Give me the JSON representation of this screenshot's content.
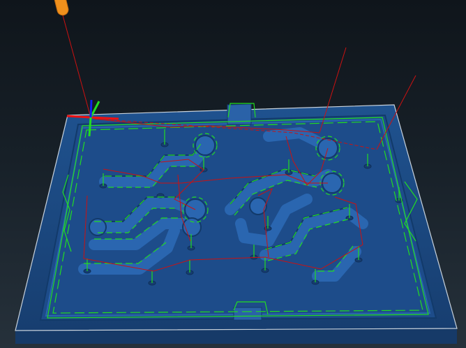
{
  "viewport": {
    "background_top": "#0f151b",
    "background_bottom": "#26313b"
  },
  "part": {
    "body_color": "#1f4f8f",
    "top_color": "#2760a8",
    "pocket_color": "#1d4c8a",
    "edge_color": "#c8d2dc"
  },
  "toolpath": {
    "cut_color": "#22dd22",
    "rapid_color": "#cc1111"
  },
  "tool": {
    "icon": "end-mill-icon",
    "color": "#f0901c"
  },
  "axes_triad": {
    "x_color": "#ee1111",
    "y_color": "#22dd22",
    "z_color": "#1122ee"
  }
}
